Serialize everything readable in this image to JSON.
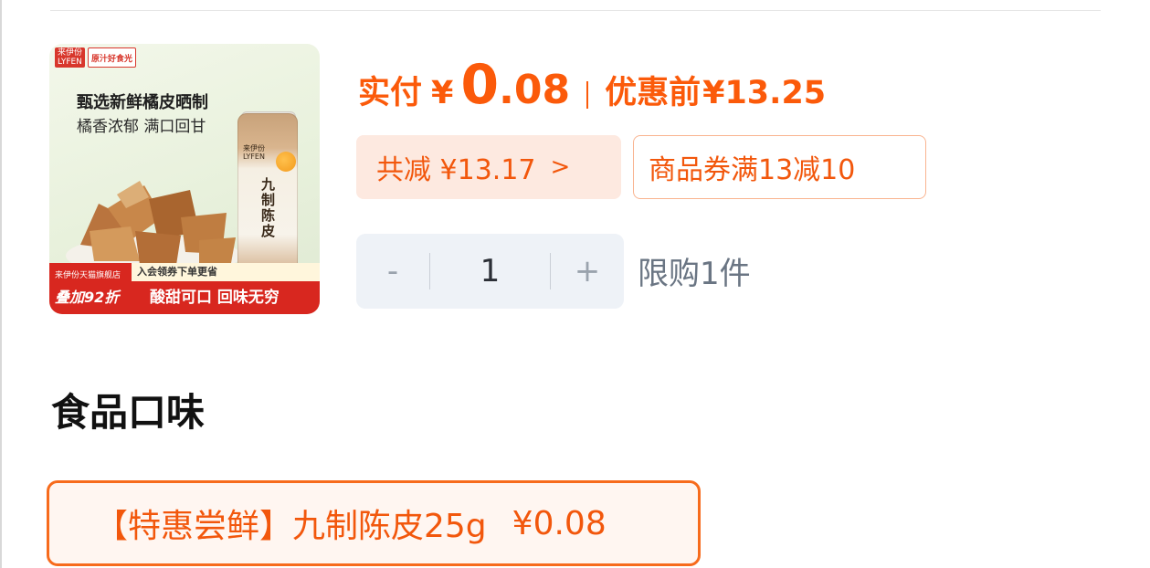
{
  "product": {
    "image": {
      "brand_primary": "来伊份",
      "brand_primary_en": "LYFEN",
      "brand_secondary": "原汁好食光",
      "headline": "甄选新鲜橘皮晒制",
      "subline": "橘香浓郁 满口回甘",
      "jar_brand": "来伊份",
      "jar_brand_en": "LYFEN",
      "jar_name": "九制陈皮",
      "store_line": "来伊份天猫旗舰店",
      "discount": "叠加92折",
      "member_line": "入会领券下单更省",
      "slogan": "酸甜可口 回味无穷"
    }
  },
  "price": {
    "pay_label": "实付",
    "currency": "¥",
    "pay_int": "0",
    "pay_dec": ".08",
    "orig_label": "优惠前",
    "orig_price": "¥13.25"
  },
  "discounts": {
    "total_label": "共减 ¥13.17",
    "total_chevron": ">",
    "coupon_label": "商品券满13减10"
  },
  "quantity": {
    "minus": "-",
    "value": "1",
    "plus": "+",
    "limit": "限购1件"
  },
  "flavor": {
    "section_title": "食品口味",
    "option_label": "【特惠尝鲜】九制陈皮25g",
    "option_price": "¥0.08"
  },
  "colors": {
    "accent": "#fb5a0a",
    "chip_bg": "#fde9e0",
    "stepper_bg": "#eef2f7"
  }
}
